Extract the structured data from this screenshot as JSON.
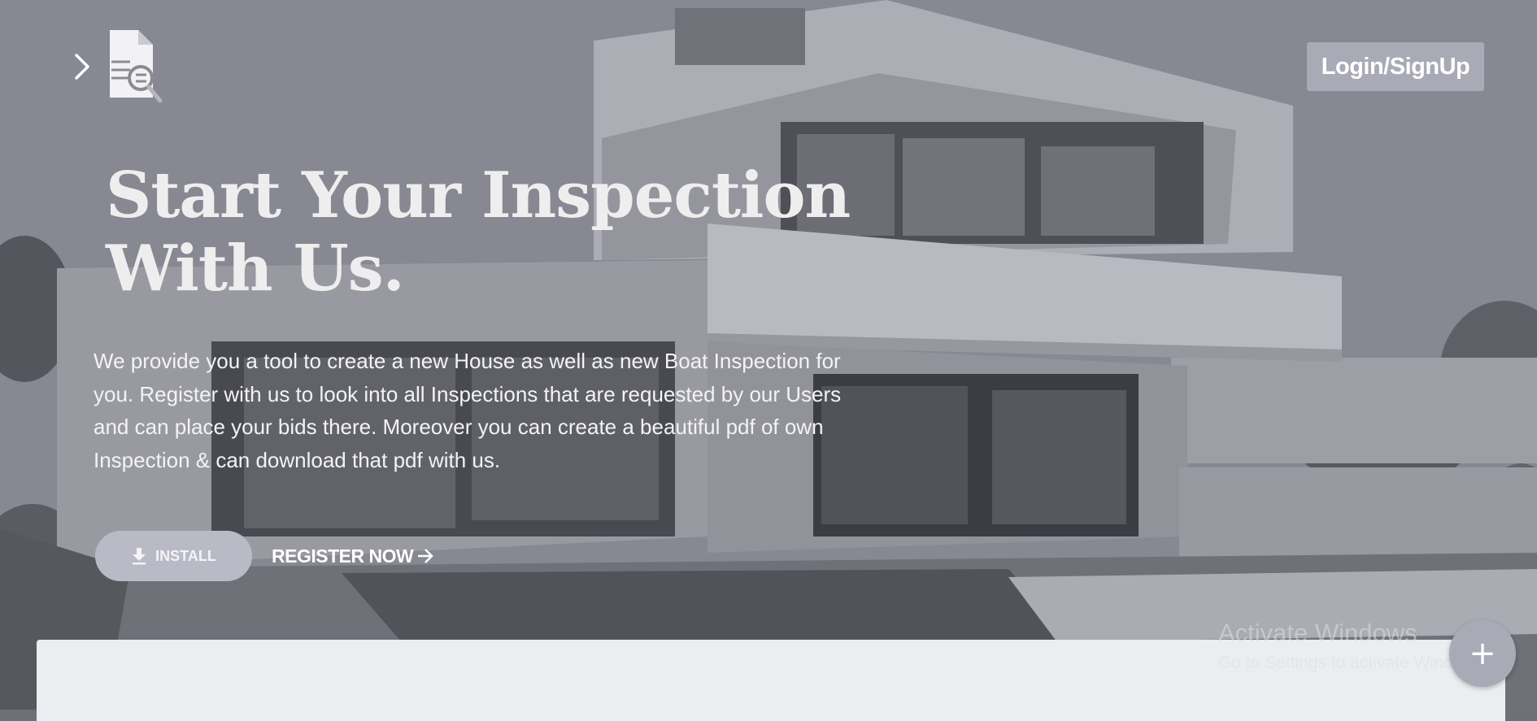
{
  "header": {
    "menu_icon": "chevron-right-icon",
    "logo_icon": "document-search-icon",
    "login_label": "Login/SignUp"
  },
  "hero": {
    "title_line1": "Start Your Inspection",
    "title_line2": "With Us.",
    "description": "We provide you a tool to create a new House as well as new Boat Inspection for you. Register with us to look into all Inspections that are requested by our Users and can place your bids there. Moreover you can create a beautiful pdf of own Inspection & can download that pdf with us.",
    "install_label": "INSTALL",
    "install_icon": "download-icon",
    "register_label": "REGISTER NOW",
    "register_icon": "arrow-right-icon"
  },
  "watermark": {
    "title": "Activate Windows",
    "subtitle": "Go to Settings to activate Windows."
  },
  "fab": {
    "icon": "plus-icon",
    "label": "+"
  },
  "colors": {
    "button_bg": "#a9aab6",
    "install_bg": "#b9bac5",
    "panel_bg": "#ecedf0",
    "text_light": "#eeeeef"
  }
}
